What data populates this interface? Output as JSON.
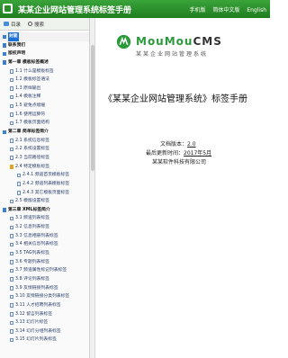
{
  "header": {
    "title": "某某企业网站管理系统标签手册",
    "links": [
      "手机版",
      "简体中文版",
      "English"
    ]
  },
  "toolbar": {
    "directory": "目录",
    "search": "搜索"
  },
  "tree": [
    {
      "label": "封面",
      "level": 0,
      "active": true
    },
    {
      "label": "联系我们",
      "level": 0
    },
    {
      "label": "版权声明",
      "level": 0
    },
    {
      "label": "第一章 模板标签概述",
      "level": 0
    },
    {
      "label": "1.1 什么是模板标签",
      "level": 1
    },
    {
      "label": "1.2 模板标签语法",
      "level": 1
    },
    {
      "label": "1.3 原样输出",
      "level": 1
    },
    {
      "label": "1.4 模板注释",
      "level": 1
    },
    {
      "label": "1.5 避免点缀缓",
      "level": 1
    },
    {
      "label": "1.6 使用运算符",
      "level": 1
    },
    {
      "label": "1.7 模板页面结构",
      "level": 1
    },
    {
      "label": "第二章 简单标签简介",
      "level": 0
    },
    {
      "label": "2.1 系统信息标签",
      "level": 1
    },
    {
      "label": "2.2 系统设置标签",
      "level": 1
    },
    {
      "label": "2.3 当前路径标签",
      "level": 1
    },
    {
      "label": "2.4 特定模板标签",
      "level": 1,
      "open": true
    },
    {
      "label": "2.4.1 频道首页模板标签",
      "level": 2
    },
    {
      "label": "2.4.2 频道列表模板标签",
      "level": 2
    },
    {
      "label": "2.4.3 其它模板页面标签",
      "level": 2
    },
    {
      "label": "2.5 模版设置标签",
      "level": 1
    },
    {
      "label": "第三章 XML标签简介",
      "level": 0
    },
    {
      "label": "3.1 频道列表标签",
      "level": 1
    },
    {
      "label": "3.2 信息列表标签",
      "level": 1
    },
    {
      "label": "3.3 信息相册列表标签",
      "level": 1
    },
    {
      "label": "3.4 相关信息列表标签",
      "level": 1
    },
    {
      "label": "3.5 TAG列表标签",
      "level": 1
    },
    {
      "label": "3.6 专题列表标签",
      "level": 1
    },
    {
      "label": "3.7 频道属性标记列表标签",
      "level": 1
    },
    {
      "label": "3.8 评论列表标签",
      "level": 1
    },
    {
      "label": "3.9 友情链接列表标签",
      "level": 1
    },
    {
      "label": "3.10 友情链接分类列表标签",
      "level": 1
    },
    {
      "label": "3.11 人才招聘列表标签",
      "level": 1
    },
    {
      "label": "3.12 留言列表标签",
      "level": 1
    },
    {
      "label": "3.13 幻灯片标签",
      "level": 1
    },
    {
      "label": "3.14 幻灯分组列表标签",
      "level": 1
    },
    {
      "label": "3.15 幻灯片列表标签",
      "level": 1
    }
  ],
  "logo": {
    "brand_main": "MouMou",
    "brand_cms": "CMS",
    "subtitle": "某某企业网站管理系统"
  },
  "document": {
    "title": "《某某企业网站管理系统》标签手册",
    "version_label": "文档版本：",
    "version_value": "2.0",
    "updated_label": "最后更新时间：",
    "updated_value": "2017年5月",
    "company": "某某软件科技有限公司"
  },
  "colors": {
    "header_bg": "#2c8c2c",
    "accent_blue": "#1e6fd6",
    "brand_green": "#2b9a3a"
  }
}
